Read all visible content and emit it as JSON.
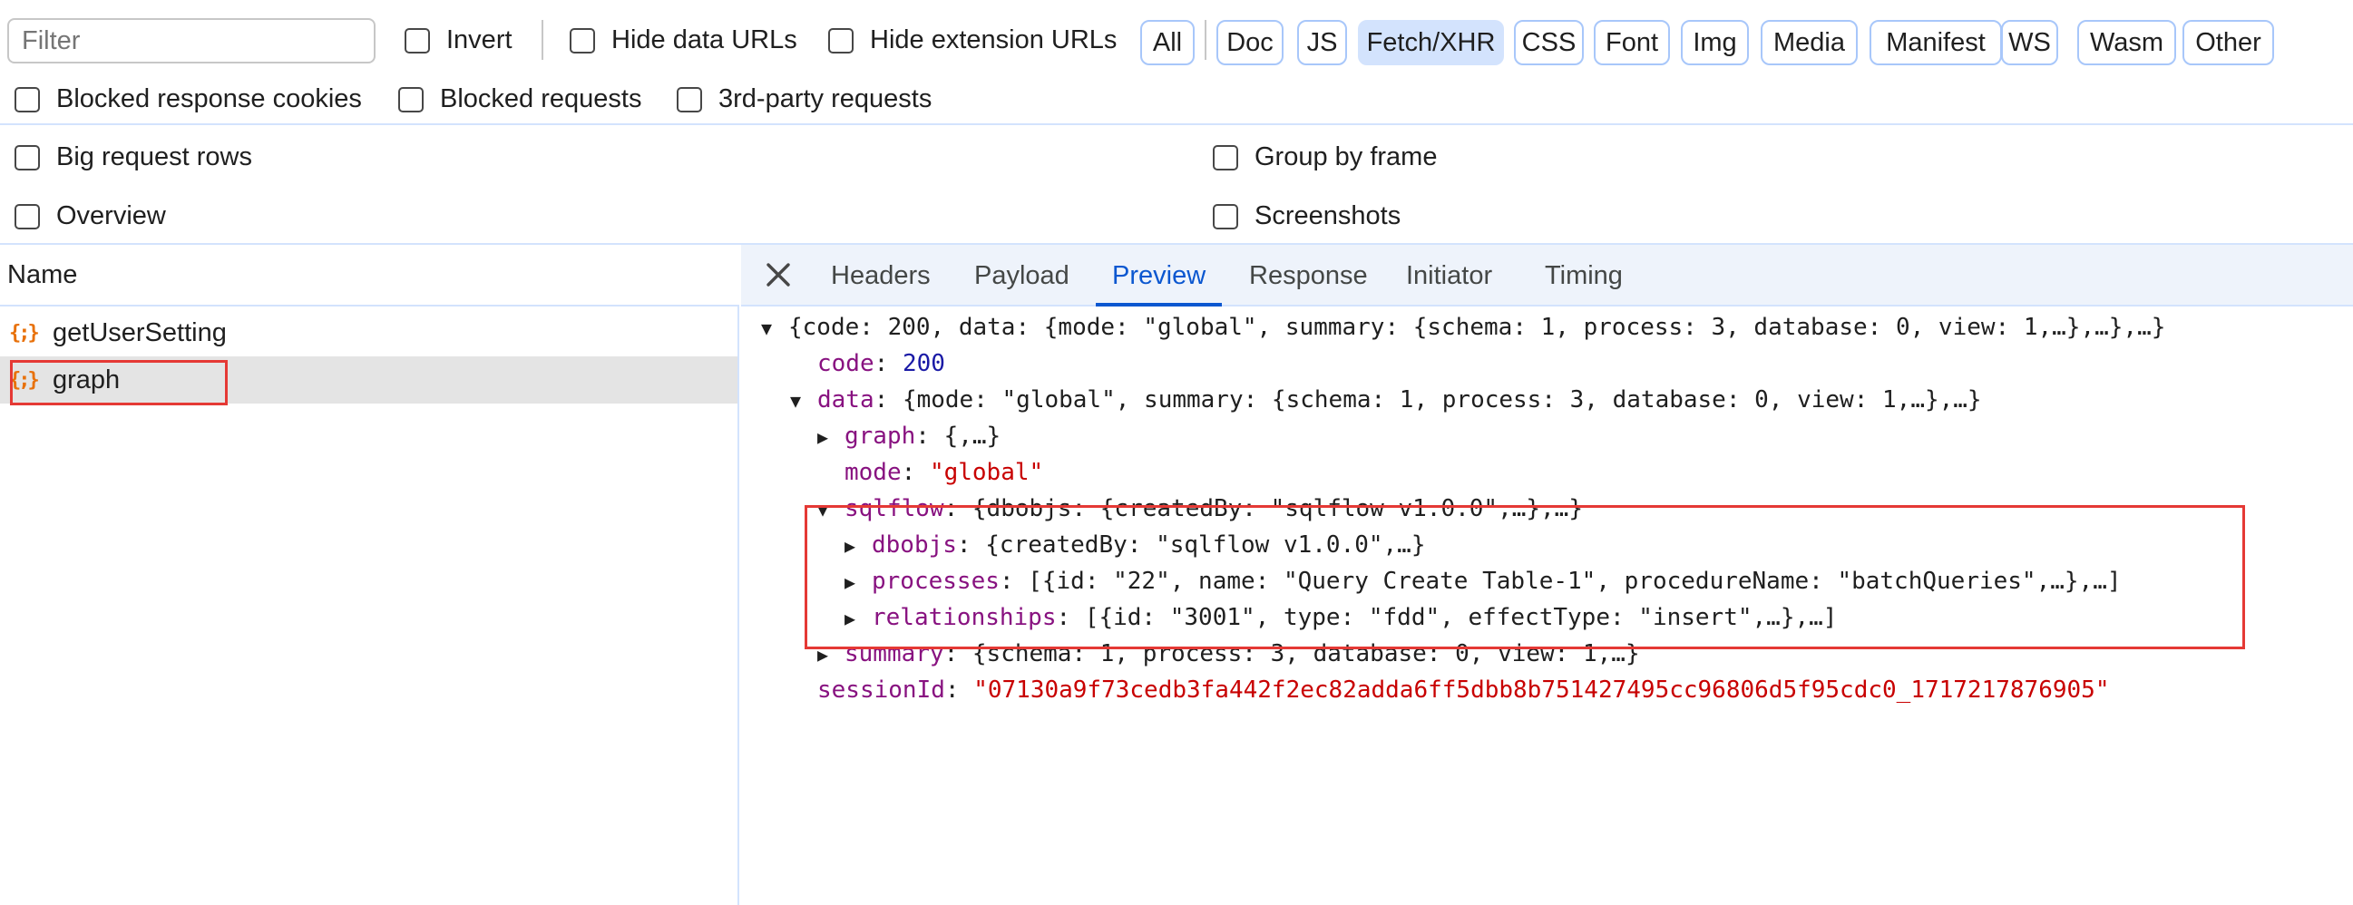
{
  "toolbar": {
    "filter_placeholder": "Filter",
    "invert": "Invert",
    "hide_data_urls": "Hide data URLs",
    "hide_extension_urls": "Hide extension URLs",
    "type_filters": [
      "All",
      "Doc",
      "JS",
      "Fetch/XHR",
      "CSS",
      "Font",
      "Img",
      "Media",
      "Manifest",
      "WS",
      "Wasm",
      "Other"
    ],
    "active_filter": "Fetch/XHR",
    "blocked_response_cookies": "Blocked response cookies",
    "blocked_requests": "Blocked requests",
    "third_party_requests": "3rd-party requests"
  },
  "settings": {
    "big_request_rows": "Big request rows",
    "group_by_frame": "Group by frame",
    "overview": "Overview",
    "screenshots": "Screenshots"
  },
  "requests": {
    "header": "Name",
    "icon": "{;}",
    "items": [
      {
        "name": "getUserSetting",
        "selected": false
      },
      {
        "name": "graph",
        "selected": true
      }
    ]
  },
  "detail": {
    "tabs": [
      "Headers",
      "Payload",
      "Preview",
      "Response",
      "Initiator",
      "Timing"
    ],
    "active_tab": "Preview",
    "preview": {
      "root_summary": "{code: 200, data: {mode: \"global\", summary: {schema: 1, process: 3, database: 0, view: 1,…},…},…}",
      "code_key": "code",
      "code_value": "200",
      "data_key": "data",
      "data_summary": "{mode: \"global\", summary: {schema: 1, process: 3, database: 0, view: 1,…},…}",
      "graph_key": "graph",
      "graph_summary": "{,…}",
      "mode_key": "mode",
      "mode_value": "\"global\"",
      "sqlflow_key": "sqlflow",
      "sqlflow_summary": "{dbobjs: {createdBy: \"sqlflow v1.0.0\",…},…}",
      "dbobjs_key": "dbobjs",
      "dbobjs_summary": "{createdBy: \"sqlflow v1.0.0\",…}",
      "processes_key": "processes",
      "processes_summary": "[{id: \"22\", name: \"Query Create Table-1\", procedureName: \"batchQueries\",…},…]",
      "relationships_key": "relationships",
      "relationships_summary": "[{id: \"3001\", type: \"fdd\", effectType: \"insert\",…},…]",
      "summary_key": "summary",
      "summary_summary": "{schema: 1, process: 3, database: 0, view: 1,…}",
      "session_key": "sessionId",
      "session_value": "\"07130a9f73cedb3fa442f2ec82adda6ff5dbb8b751427495cc96806d5f95cdc0_1717217876905\""
    }
  },
  "colors": {
    "accent": "#0b57d0",
    "chip_active_bg": "#d3e3fd",
    "highlight_box": "#e53935",
    "json_key": "#881280",
    "json_string": "#c80000",
    "json_number": "#1a1aa6"
  }
}
